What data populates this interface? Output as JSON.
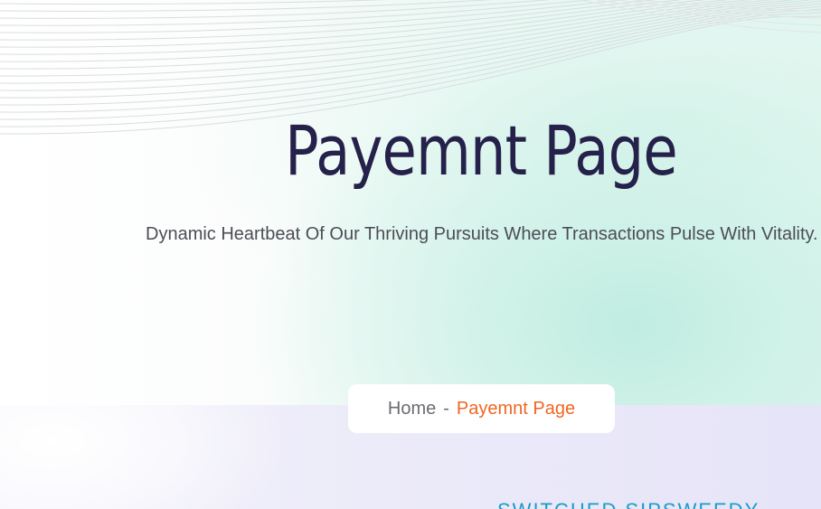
{
  "hero": {
    "title": "Payemnt Page",
    "subtitle": "Dynamic Heartbeat Of Our Thriving Pursuits Where Transactions Pulse With Vitality."
  },
  "breadcrumb": {
    "home": "Home",
    "separator": "-",
    "current": "Payemnt Page"
  },
  "section": {
    "heading_partial": "SWITCHED SIPSWEEDY"
  },
  "colors": {
    "title": "#25214a",
    "accent": "#f06624",
    "subtitle": "#4d4d55",
    "heading": "#1a9cc8"
  }
}
